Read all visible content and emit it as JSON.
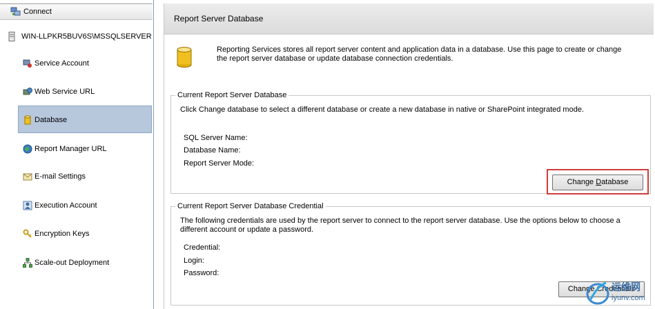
{
  "nav": {
    "connect_label": "Connect",
    "server_name": "WIN-LLPKR5BUV6S\\MSSQLSERVER",
    "items": [
      {
        "label": "Service Account",
        "icon": "service-account-icon"
      },
      {
        "label": "Web Service URL",
        "icon": "web-service-url-icon"
      },
      {
        "label": "Database",
        "icon": "database-icon",
        "selected": true
      },
      {
        "label": "Report Manager URL",
        "icon": "globe-icon"
      },
      {
        "label": "E-mail Settings",
        "icon": "email-icon"
      },
      {
        "label": "Execution Account",
        "icon": "execution-account-icon"
      },
      {
        "label": "Encryption Keys",
        "icon": "keys-icon"
      },
      {
        "label": "Scale-out Deployment",
        "icon": "scale-out-icon"
      }
    ]
  },
  "page": {
    "title": "Report Server Database",
    "intro": "Reporting Services stores all report server content and application data in a database. Use this page to create or change the report server database or update database connection credentials."
  },
  "current_db": {
    "legend": "Current Report Server Database",
    "description": "Click Change database to select a different database or create a new database in native or SharePoint integrated mode.",
    "sql_server_label": "SQL Server Name:",
    "database_name_label": "Database Name:",
    "mode_label": "Report Server Mode:",
    "button_pre": "Change ",
    "button_underlined": "D",
    "button_post": "atabase"
  },
  "credential": {
    "legend": "Current Report Server Database Credential",
    "description": "The following credentials are used by the report server to connect to the report server database.  Use the options below to choose a different account or update a password.",
    "credential_label": "Credential:",
    "login_label": "Login:",
    "password_label": "Password:",
    "button_label": "Change Credentials"
  },
  "watermark": {
    "line1": "运维网",
    "line2": "iyunv.com"
  },
  "colors": {
    "selection": "#b7c8dd",
    "highlight": "#d23b3b",
    "database_icon": "#f0c020"
  }
}
